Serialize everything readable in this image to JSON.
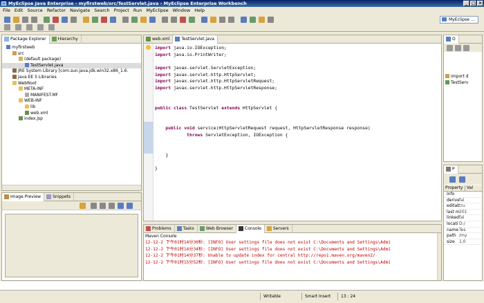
{
  "window": {
    "title": "MyEclipse Java Enterprise - myfirstweb/src/TestServlet.java - MyEclipse Enterprise Workbench"
  },
  "menu": [
    "File",
    "Edit",
    "Source",
    "Refactor",
    "Navigate",
    "Search",
    "Project",
    "Run",
    "MyEclipse",
    "Window",
    "Help"
  ],
  "perspective": {
    "label": "MyEclipse ..."
  },
  "left_panel": {
    "tabs": [
      "Package Explorer",
      "Hierarchy"
    ],
    "tree": [
      {
        "label": "myfirstweb",
        "indent": 0,
        "icon": "project"
      },
      {
        "label": "src",
        "indent": 1,
        "icon": "source-folder"
      },
      {
        "label": "(default package)",
        "indent": 2,
        "icon": "package"
      },
      {
        "label": "TestServlet.java",
        "indent": 3,
        "icon": "java-file",
        "selected": true
      },
      {
        "label": "JRE System Library [com.sun.java.jdk.win32.x86_1.6.",
        "indent": 1,
        "icon": "library"
      },
      {
        "label": "Java EE 5 Libraries",
        "indent": 1,
        "icon": "library"
      },
      {
        "label": "WebRoot",
        "indent": 1,
        "icon": "folder"
      },
      {
        "label": "META-INF",
        "indent": 2,
        "icon": "folder"
      },
      {
        "label": "MANIFEST.MF",
        "indent": 3,
        "icon": "file"
      },
      {
        "label": "WEB-INF",
        "indent": 2,
        "icon": "folder"
      },
      {
        "label": "lib",
        "indent": 3,
        "icon": "folder"
      },
      {
        "label": "web.xml",
        "indent": 3,
        "icon": "xml-file"
      },
      {
        "label": "index.jsp",
        "indent": 2,
        "icon": "jsp-file"
      }
    ]
  },
  "left_bottom_panel": {
    "tabs": [
      "Image Preview",
      "Snippets"
    ]
  },
  "editor": {
    "tabs": [
      "web.xml",
      "TestServlet.java"
    ],
    "lines": [
      "import java.io.IOException;",
      "import java.io.PrintWriter;",
      "",
      "import javax.servlet.ServletException;",
      "import javax.servlet.http.HttpServlet;",
      "import javax.servlet.http.HttpServletRequest;",
      "import javax.servlet.http.HttpServletResponse;",
      "",
      "",
      "public class TestServlet extends HttpServlet {",
      "",
      "",
      "    public void service(HttpServletRequest request, HttpServletResponse response)",
      "            throws ServletException, IOException {",
      "",
      "",
      "    }",
      "",
      "}"
    ]
  },
  "console": {
    "tabs": [
      "Problems",
      "Tasks",
      "Web Browser",
      "Console",
      "Servers"
    ],
    "title": "Maven Console",
    "lines": [
      "12-12-2 下午01时14分30秒: [INFO] User settings file does not exist C:\\Documents and Settings\\Admi",
      "12-12-2 下午01时14分34秒: [INFO] User settings file does not exist C:\\Documents and Settings\\Admi",
      "12-12-2 下午01时14分37秒: Unable to update index for central http://repo1.maven.org/maven2/",
      "12-12-2 下午01时15分52秒: [INFO] User settings file does not exist C:\\Documents and Settings\\Admi"
    ]
  },
  "outline_panel": {
    "tabs": [
      "O"
    ],
    "tree": [
      "import d",
      "TestServ"
    ]
  },
  "properties_panel": {
    "tabs": [
      "P"
    ],
    "columns": [
      "Property",
      "Val"
    ],
    "rows": [
      {
        "key": "Info",
        "value": ""
      },
      {
        "key": "derive",
        "value": "fal"
      },
      {
        "key": "editab",
        "value": "tru"
      },
      {
        "key": "last m",
        "value": "201"
      },
      {
        "key": "linked",
        "value": "fal"
      },
      {
        "key": "locati",
        "value": "D:/"
      },
      {
        "key": "name",
        "value": "Tes"
      },
      {
        "key": "path",
        "value": "/my"
      },
      {
        "key": "size",
        "value": "1,0"
      }
    ]
  },
  "statusbar": {
    "writable": "Writable",
    "insert_mode": "Smart Insert",
    "position": "13 : 24"
  }
}
